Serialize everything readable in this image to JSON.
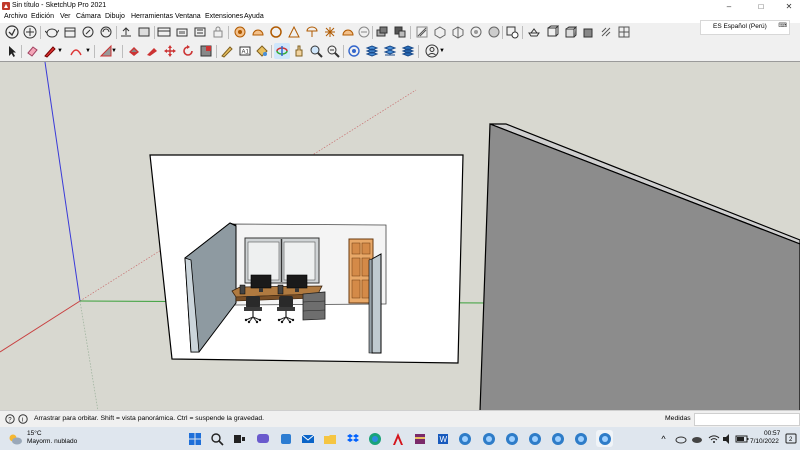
{
  "window": {
    "title": "Sin título - SketchUp Pro 2021",
    "minimize_glyph": "–",
    "maximize_glyph": "□",
    "close_glyph": "✕"
  },
  "menu": [
    "Archivo",
    "Edición",
    "Ver",
    "Cámara",
    "Dibujo",
    "Herramientas",
    "Ventana",
    "Extensiones",
    "Ayuda"
  ],
  "language": {
    "label": "ES Español (Perú)"
  },
  "toolbar_row1": [
    {
      "name": "sketchup-logo-icon"
    },
    {
      "name": "warehouse-icon"
    },
    {
      "name": "teapot-icon"
    },
    {
      "name": "extension-warehouse-icon"
    },
    {
      "name": "share-icon"
    },
    {
      "name": "layout-icon"
    },
    {
      "name": "style-builder-icon"
    },
    {
      "name": "scenes-icon"
    },
    {
      "name": "outliner-icon"
    },
    {
      "name": "lock-icon"
    },
    {
      "name": "settings-icon"
    },
    {
      "name": "sandbox-icon"
    },
    {
      "name": "target-icon"
    },
    {
      "name": "protractor-icon"
    },
    {
      "name": "axes-icon"
    },
    {
      "name": "sun-icon"
    },
    {
      "name": "umbrella-icon"
    },
    {
      "name": "hardhat-icon"
    },
    {
      "name": "sections-icon"
    },
    {
      "name": "layers-icon"
    },
    {
      "name": "iso-view-icon"
    },
    {
      "name": "top-view-icon"
    },
    {
      "name": "front-view-icon"
    },
    {
      "name": "right-view-icon"
    },
    {
      "name": "back-view-icon"
    },
    {
      "name": "left-view-icon"
    },
    {
      "name": "parallel-icon"
    },
    {
      "name": "xray-icon"
    },
    {
      "name": "wireframe-icon"
    },
    {
      "name": "hidden-line-icon"
    },
    {
      "name": "shaded-icon"
    },
    {
      "name": "textured-icon"
    },
    {
      "name": "monochrome-icon"
    },
    {
      "name": "back-edges-icon"
    }
  ],
  "toolbar_row2": [
    {
      "name": "select-icon"
    },
    {
      "name": "eraser-icon"
    },
    {
      "name": "pencil-icon"
    },
    {
      "name": "shapes-icon"
    },
    {
      "name": "push-pull-icon"
    },
    {
      "name": "paint-icon"
    },
    {
      "name": "follow-me-icon"
    },
    {
      "name": "move-icon"
    },
    {
      "name": "rotate-icon"
    },
    {
      "name": "scale-icon"
    },
    {
      "name": "tape-icon"
    },
    {
      "name": "text-icon"
    },
    {
      "name": "paint-bucket-icon"
    },
    {
      "name": "orbit-icon"
    },
    {
      "name": "pan-icon"
    },
    {
      "name": "zoom-icon"
    },
    {
      "name": "zoom-extents-icon"
    },
    {
      "name": "walk-icon"
    },
    {
      "name": "section-plane-icon"
    },
    {
      "name": "section-fill-icon"
    },
    {
      "name": "display-sections-icon"
    },
    {
      "name": "account-icon"
    }
  ],
  "status": {
    "message": "Arrastrar para orbitar. Shift = vista panorámica. Ctrl = suspende la gravedad.",
    "measure_label": "Medidas",
    "measure_value": ""
  },
  "taskbar": {
    "weather_temp": "15°C",
    "weather_cond": "Mayorm. nublado",
    "time": "00:57",
    "date": "7/10/2022"
  }
}
